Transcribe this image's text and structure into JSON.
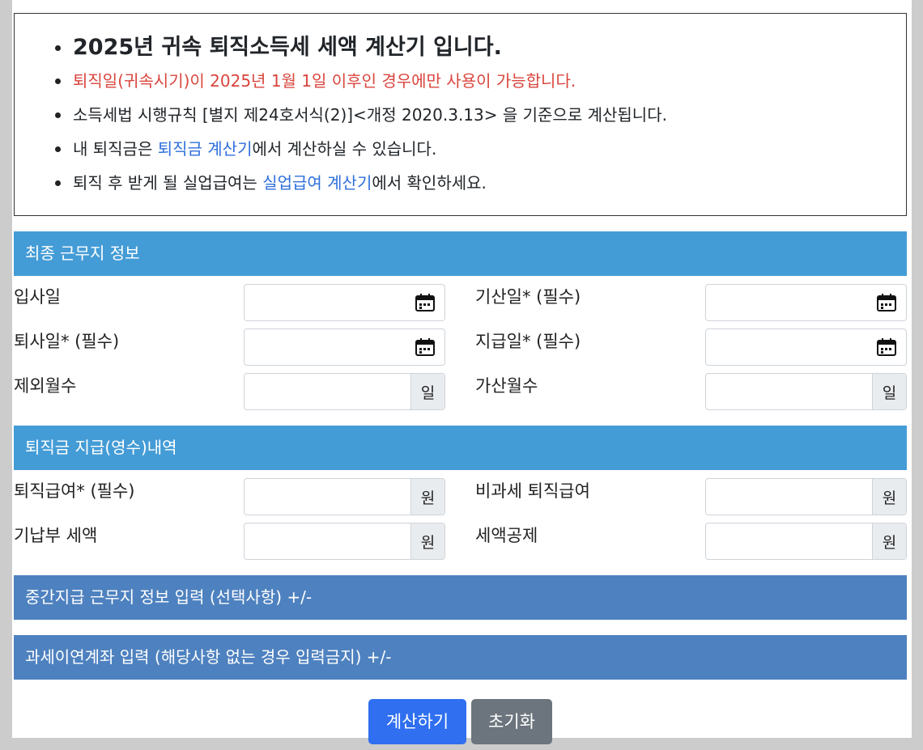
{
  "notice": {
    "title": "2025년 귀속 퇴직소득세 세액 계산기 입니다.",
    "warning": "퇴직일(귀속시기)이 2025년 1월 1일 이후인 경우에만 사용이 가능합니다.",
    "basis": "소득세법 시행규칙 [별지 제24호서식(2)]<개정 2020.3.13> 을 기준으로 계산됩니다.",
    "line4_prefix": "내 퇴직금은 ",
    "line4_link": "퇴직금 계산기",
    "line4_suffix": "에서 계산하실 수 있습니다.",
    "line5_prefix": "퇴직 후 받게 될 실업급여는 ",
    "line5_link": "실업급여 계산기",
    "line5_suffix": "에서 확인하세요."
  },
  "section1": {
    "title": "최종 근무지 정보",
    "join_date_label": "입사일",
    "start_date_label": "기산일* (필수)",
    "leave_date_label": "퇴사일* (필수)",
    "pay_date_label": "지급일* (필수)",
    "excluded_months_label": "제외월수",
    "added_months_label": "가산월수",
    "day_unit": "일"
  },
  "section2": {
    "title": "퇴직금 지급(영수)내역",
    "severance_label": "퇴직급여* (필수)",
    "nontax_label": "비과세 퇴직급여",
    "prepaid_tax_label": "기납부 세액",
    "tax_credit_label": "세액공제",
    "won_unit": "원"
  },
  "section3": {
    "title": "중간지급 근무지 정보 입력 (선택사항) +/-"
  },
  "section4": {
    "title": "과세이연계좌 입력 (해당사항 없는 경우 입력금지) +/-"
  },
  "buttons": {
    "calculate": "계산하기",
    "reset": "초기화"
  },
  "icons": {
    "date": "calendar-icon"
  },
  "colors": {
    "section_light": "#449cd6",
    "section_dark": "#4e81bf",
    "primary": "#2f6ff0",
    "secondary": "#6c757d",
    "warning": "#d9453d",
    "link": "#2f6fdc"
  }
}
